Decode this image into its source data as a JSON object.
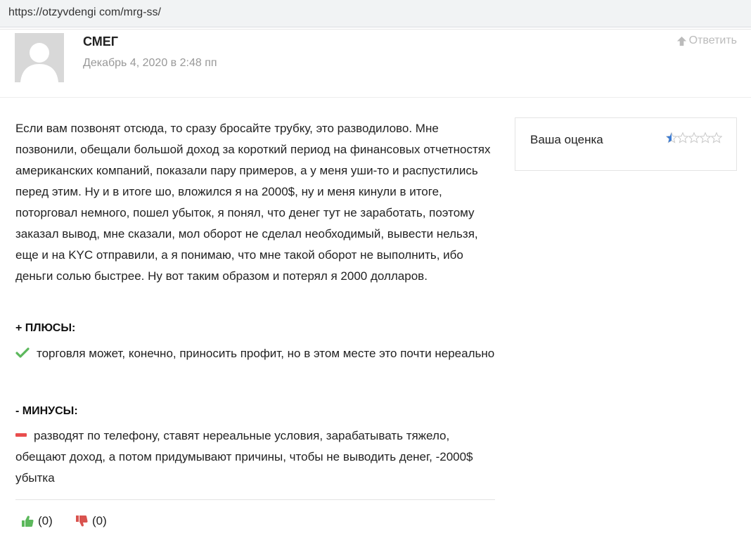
{
  "browser": {
    "url": "https://otzyvdengi com/mrg-ss/"
  },
  "comment": {
    "author": "СМЕГ",
    "date": "Декабрь 4, 2020 в 2:48 пп",
    "reply_label": "Ответить",
    "body": "Если вам позвонят отсюда, то сразу бросайте трубку, это разводилово. Мне позвонили, обещали большой доход за короткий период на финансовых отчетностях американских компаний, показали пару примеров, а у меня уши-то и распустились перед этим. Ну и в итоге шо, вложился я на 2000$, ну и меня кинули в итоге, поторговал немного, пошел убыток, я понял, что денег тут не заработать, поэтому заказал вывод, мне сказали, мол оборот не сделал необходимый, вывести нельзя, еще и на KYC отправили, а я понимаю, что мне такой оборот не выполнить, ибо деньги солью быстрее. Ну вот таким образом и потерял я 2000 долларов.",
    "pros_heading": "+ ПЛЮСЫ:",
    "pros_text": "торговля может, конечно, приносить профит, но в этом месте это почти нереально",
    "cons_heading": "- МИНУСЫ:",
    "cons_text": "разводят по телефону, ставят нереальные условия, зарабатывать тяжело, обещают доход, а потом придумывают причины, чтобы не выводить денег, -2000$ убытка",
    "likes": "(0)",
    "dislikes": "(0)"
  },
  "rating": {
    "label": "Ваша оценка",
    "value": 0.5,
    "max": 5,
    "star_color": "#3a7bd5"
  },
  "colors": {
    "check": "#5cb85c",
    "minus": "#e94d4d",
    "like": "#5cb85c",
    "dislike": "#d9534f"
  }
}
